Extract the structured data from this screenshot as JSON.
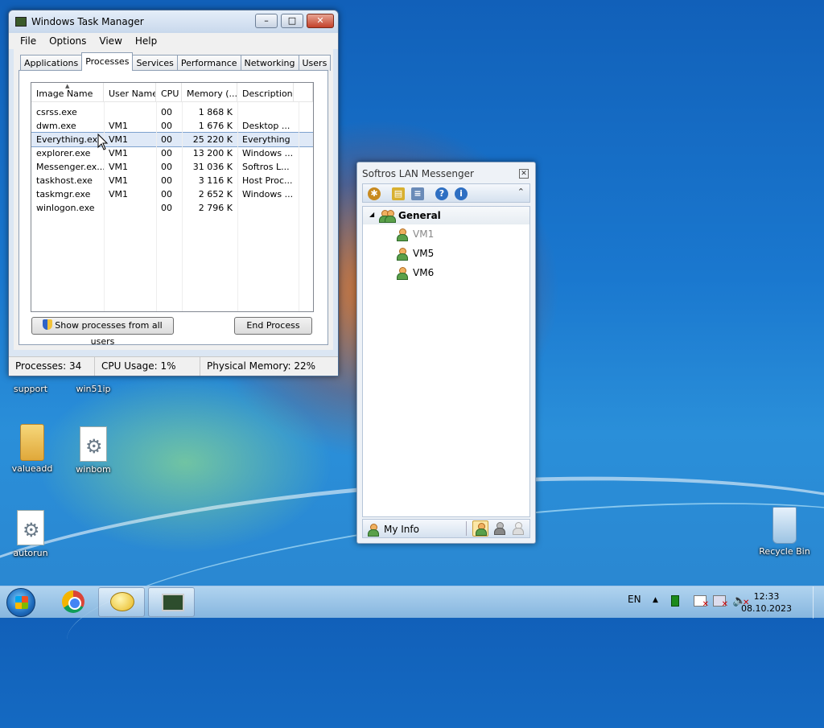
{
  "desktop": {
    "icons": [
      {
        "label": "support",
        "icon": "gear-file-icon"
      },
      {
        "label": "win51ip",
        "icon": "gear-file-icon"
      },
      {
        "label": "valueadd",
        "icon": "folder-icon"
      },
      {
        "label": "winbom",
        "icon": "gear-file-icon"
      },
      {
        "label": "autorun",
        "icon": "gear-file-icon"
      },
      {
        "label": "Recycle Bin",
        "icon": "recycle-bin-icon"
      }
    ]
  },
  "task_manager": {
    "title": "Windows Task Manager",
    "menu": [
      "File",
      "Options",
      "View",
      "Help"
    ],
    "tabs": [
      "Applications",
      "Processes",
      "Services",
      "Performance",
      "Networking",
      "Users"
    ],
    "active_tab": "Processes",
    "columns": [
      "Image Name",
      "User Name",
      "CPU",
      "Memory (...",
      "Description"
    ],
    "rows": [
      {
        "name": "csrss.exe",
        "user": "",
        "cpu": "00",
        "mem": "1 868 K",
        "desc": ""
      },
      {
        "name": "dwm.exe",
        "user": "VM1",
        "cpu": "00",
        "mem": "1 676 K",
        "desc": "Desktop ..."
      },
      {
        "name": "Everything.exe",
        "user": "VM1",
        "cpu": "00",
        "mem": "25 220 K",
        "desc": "Everything"
      },
      {
        "name": "explorer.exe",
        "user": "VM1",
        "cpu": "00",
        "mem": "13 200 K",
        "desc": "Windows ..."
      },
      {
        "name": "Messenger.ex...",
        "user": "VM1",
        "cpu": "00",
        "mem": "31 036 K",
        "desc": "Softros L..."
      },
      {
        "name": "taskhost.exe",
        "user": "VM1",
        "cpu": "00",
        "mem": "3 116 K",
        "desc": "Host Proc..."
      },
      {
        "name": "taskmgr.exe",
        "user": "VM1",
        "cpu": "00",
        "mem": "2 652 K",
        "desc": "Windows ..."
      },
      {
        "name": "winlogon.exe",
        "user": "",
        "cpu": "00",
        "mem": "2 796 K",
        "desc": ""
      }
    ],
    "selected_row": 2,
    "show_all_label": "Show processes from all users",
    "end_process_label": "End Process",
    "status": {
      "processes": "Processes: 34",
      "cpu": "CPU Usage: 1%",
      "memory": "Physical Memory: 22%"
    }
  },
  "messenger": {
    "title": "Softros LAN Messenger",
    "group": "General",
    "users": [
      {
        "name": "VM1",
        "online": false
      },
      {
        "name": "VM5",
        "online": true
      },
      {
        "name": "VM6",
        "online": true
      }
    ],
    "my_info_label": "My Info"
  },
  "taskbar": {
    "language": "EN",
    "time": "12:33",
    "date": "08.10.2023"
  }
}
